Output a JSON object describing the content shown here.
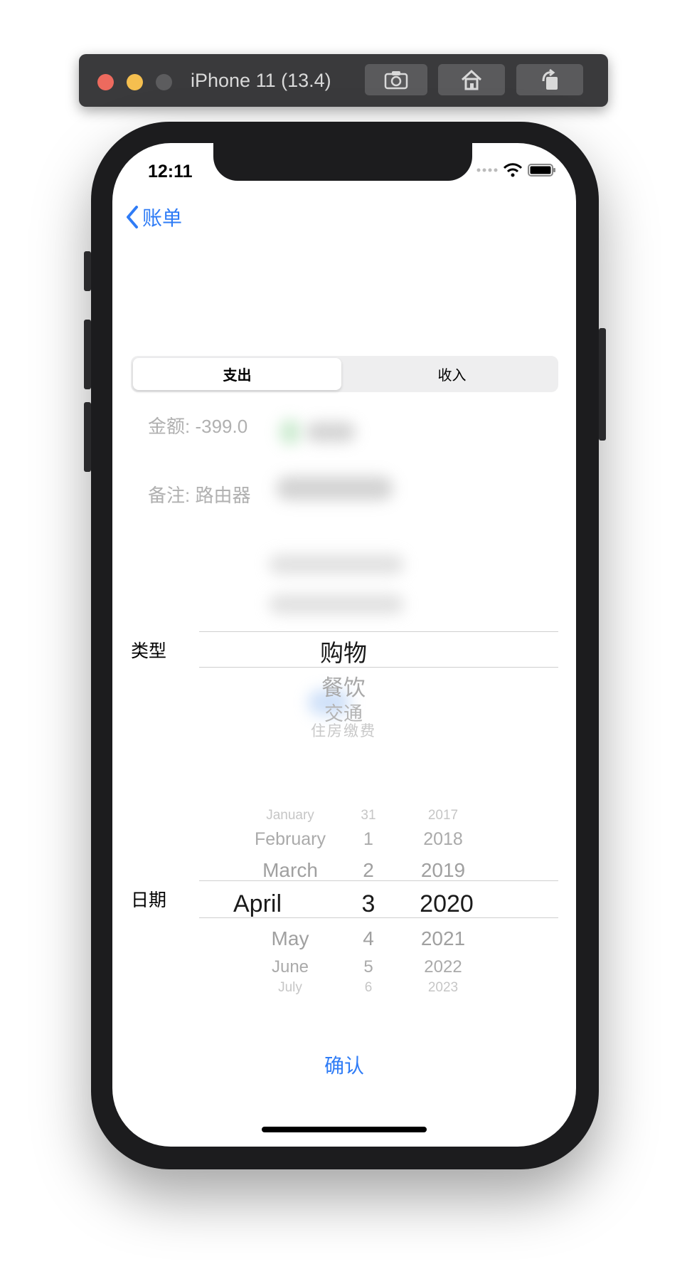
{
  "simulator": {
    "title": "iPhone 11 (13.4)",
    "buttons": [
      "screenshot-icon",
      "home-icon",
      "rotate-icon"
    ]
  },
  "status_bar": {
    "time": "12:11"
  },
  "nav": {
    "back_label": "账单"
  },
  "segment": {
    "expense": "支出",
    "income": "收入",
    "selected": "支出"
  },
  "details": {
    "amount": "金额: -399.0",
    "note": "备注: 路由器"
  },
  "type_picker": {
    "label": "类型",
    "selected": "购物",
    "below": [
      "餐饮",
      "交通",
      "住房缴费"
    ]
  },
  "date_picker": {
    "label": "日期",
    "months_above": [
      "January",
      "February",
      "March"
    ],
    "month_selected": "April",
    "months_below": [
      "May",
      "June",
      "July"
    ],
    "days_above": [
      "31",
      "1",
      "2"
    ],
    "day_selected": "3",
    "days_below": [
      "4",
      "5",
      "6"
    ],
    "years_above": [
      "2017",
      "2018",
      "2019"
    ],
    "year_selected": "2020",
    "years_below": [
      "2021",
      "2022",
      "2023"
    ]
  },
  "confirm_label": "确认",
  "colors": {
    "accent": "#2f7cf6",
    "phone_frame": "#1c1c1e"
  }
}
